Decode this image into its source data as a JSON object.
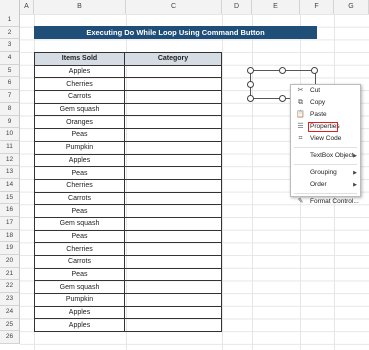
{
  "sheet": {
    "columns": [
      "A",
      "B",
      "C",
      "D",
      "E",
      "F",
      "G"
    ],
    "rows": [
      "1",
      "2",
      "3",
      "4",
      "5",
      "6",
      "7",
      "8",
      "9",
      "10",
      "11",
      "12",
      "13",
      "14",
      "15",
      "16",
      "17",
      "18",
      "19",
      "20",
      "21",
      "22",
      "23",
      "24",
      "25",
      "26"
    ]
  },
  "title": "Executing Do While Loop Using Command Button",
  "table": {
    "headers": [
      "Items Sold",
      "Category"
    ],
    "items": [
      "Apples",
      "Cherries",
      "Carrots",
      "Gem squash",
      "Oranges",
      "Peas",
      "Pumpkin",
      "Apples",
      "Peas",
      "Cherries",
      "Carrots",
      "Peas",
      "Gem squash",
      "Peas",
      "Cherries",
      "Carrots",
      "Peas",
      "Gem squash",
      "Pumpkin",
      "Apples",
      "Apples"
    ]
  },
  "menu": {
    "cut": "Cut",
    "copy": "Copy",
    "paste": "Paste",
    "properties": "Properties",
    "view_code": "View Code",
    "textbox_object": "TextBox Object",
    "grouping": "Grouping",
    "order": "Order",
    "format_control": "Format Control..."
  }
}
